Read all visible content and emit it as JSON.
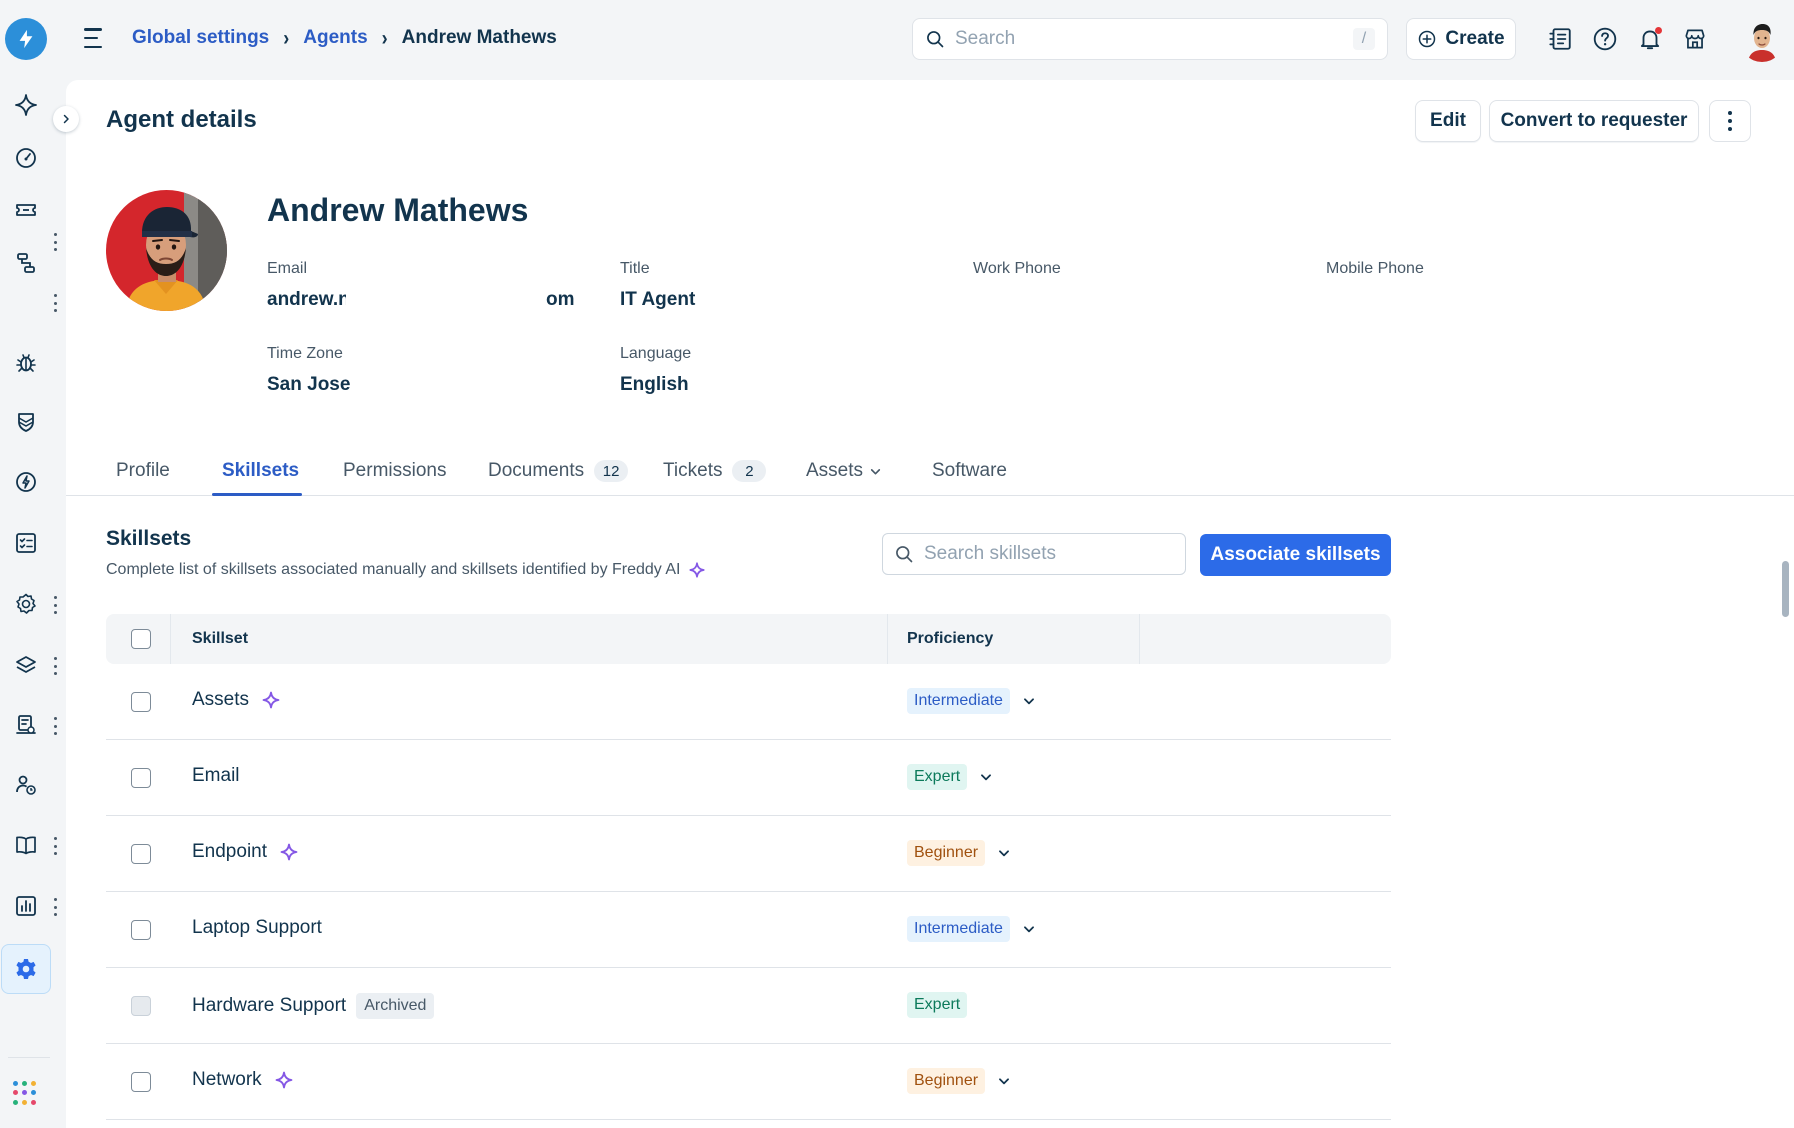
{
  "breadcrumb": {
    "items": [
      "Global settings",
      "Agents"
    ],
    "current": "Andrew Mathews"
  },
  "search": {
    "placeholder": "Search",
    "shortcut": "/"
  },
  "create_label": "Create",
  "page": {
    "title": "Agent details",
    "edit_label": "Edit",
    "convert_label": "Convert to requester"
  },
  "agent": {
    "name": "Andrew Mathews",
    "fields": {
      "email": {
        "label": "Email",
        "value_start": "andrew.n",
        "value_end": "om"
      },
      "title": {
        "label": "Title",
        "value": "IT Agent"
      },
      "work_phone": {
        "label": "Work Phone",
        "value": ""
      },
      "mobile_phone": {
        "label": "Mobile Phone",
        "value": ""
      },
      "time_zone": {
        "label": "Time Zone",
        "value": "San Jose"
      },
      "language": {
        "label": "Language",
        "value": "English"
      }
    }
  },
  "tabs": [
    {
      "label": "Profile"
    },
    {
      "label": "Skillsets",
      "active": true
    },
    {
      "label": "Permissions"
    },
    {
      "label": "Documents",
      "count": "12"
    },
    {
      "label": "Tickets",
      "count": "2"
    },
    {
      "label": "Assets",
      "dropdown": true
    },
    {
      "label": "Software"
    }
  ],
  "skillsets": {
    "title": "Skillsets",
    "description": "Complete list of skillsets associated manually and skillsets identified by Freddy AI",
    "search_placeholder": "Search skillsets",
    "associate_label": "Associate skillsets",
    "columns": {
      "skillset": "Skillset",
      "proficiency": "Proficiency"
    },
    "rows": [
      {
        "name": "Assets",
        "ai": true,
        "proficiency": "Intermediate",
        "dropdown": true
      },
      {
        "name": "Email",
        "ai": false,
        "proficiency": "Expert",
        "dropdown": true
      },
      {
        "name": "Endpoint",
        "ai": true,
        "proficiency": "Beginner",
        "dropdown": true
      },
      {
        "name": "Laptop Support",
        "ai": false,
        "proficiency": "Intermediate",
        "dropdown": true
      },
      {
        "name": "Hardware Support",
        "ai": false,
        "archived": "Archived",
        "proficiency": "Expert",
        "dropdown": false
      },
      {
        "name": "Network",
        "ai": true,
        "proficiency": "Beginner",
        "dropdown": true
      }
    ]
  },
  "colors": {
    "accent": "#2c5cc5",
    "primary_button": "#2c6be8",
    "logo": "#2c8fd9",
    "ai_sparkle": "#8457e5",
    "notification": "#e43538"
  },
  "icons": {
    "rail": [
      "sparkle-icon",
      "dashboard-icon",
      "ticket-icon",
      "workflow-icon",
      "bug-icon",
      "shield-icon",
      "change-icon",
      "checklist-icon",
      "settings-gear-icon",
      "layers-icon",
      "laptop-icon",
      "user-clock-icon",
      "book-icon",
      "reports-icon",
      "admin-gear-icon",
      "apps-grid-icon"
    ],
    "top": [
      "contacts-icon",
      "help-icon",
      "bell-icon",
      "store-icon"
    ]
  }
}
